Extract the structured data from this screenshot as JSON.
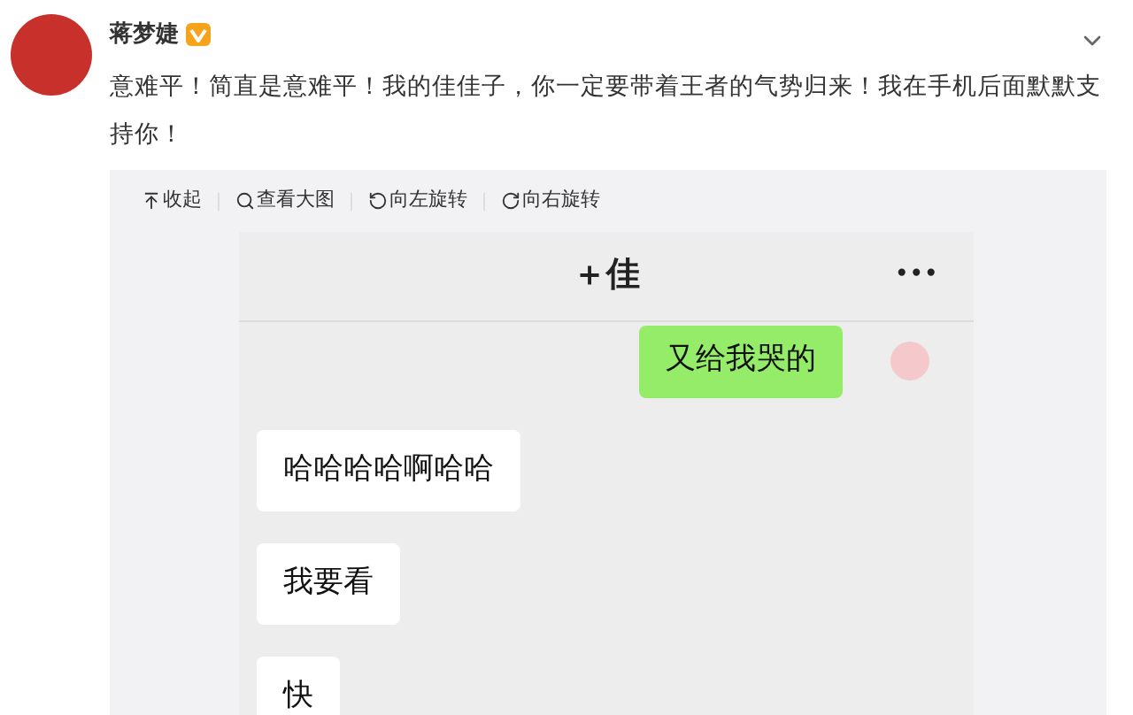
{
  "post": {
    "author": "蒋梦婕",
    "verified": true,
    "text": "意难平！简直是意难平！我的佳佳子，你一定要带着王者的气势归来！我在手机后面默默支持你！"
  },
  "image_toolbar": [
    "收起",
    "查看大图",
    "向左旋转",
    "向右旋转"
  ],
  "chat": {
    "title": "＋佳",
    "more": "•••",
    "messages": [
      {
        "kind": "sent",
        "text": "又给我哭的"
      },
      {
        "kind": "received",
        "text": "哈哈哈哈啊哈哈"
      },
      {
        "kind": "received",
        "text": "我要看"
      },
      {
        "kind": "received",
        "text": "快"
      }
    ]
  }
}
